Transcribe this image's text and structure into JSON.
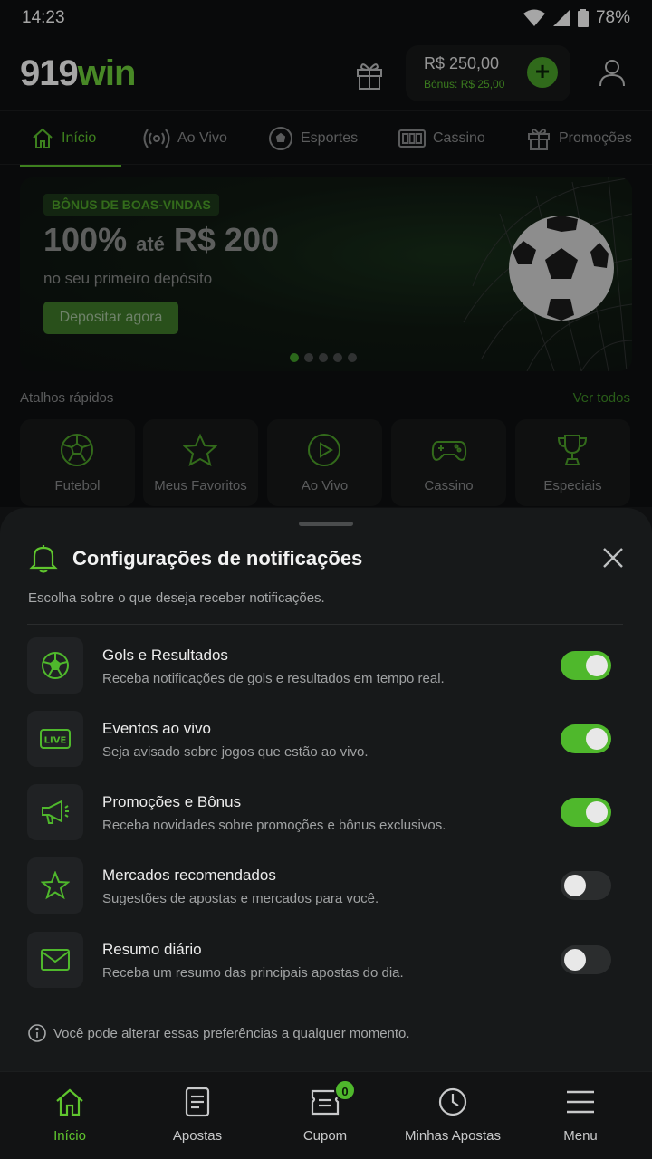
{
  "status_bar": {
    "time": "14:23",
    "battery": "78%"
  },
  "header": {
    "logo_main": "919",
    "logo_accent": "win",
    "balance": "R$ 250,00",
    "bonus": "Bônus: R$ 25,00"
  },
  "nav": {
    "tabs": [
      {
        "label": "Início",
        "icon": "home-icon"
      },
      {
        "label": "Ao Vivo",
        "icon": "live-icon"
      },
      {
        "label": "Esportes",
        "icon": "soccer-ball-icon"
      },
      {
        "label": "Cassino",
        "icon": "slot-machine-icon"
      },
      {
        "label": "Promoções",
        "icon": "gift-icon"
      }
    ]
  },
  "banner": {
    "badge": "BÔNUS DE BOAS-VINDAS",
    "title_pct": "100%",
    "title_mid": "até",
    "title_amount": "R$ 200",
    "subtitle": "no seu primeiro depósito",
    "cta": "Depositar agora",
    "slides": 5,
    "active_slide": 1
  },
  "shortcuts": {
    "title": "Atalhos rápidos",
    "see_all": "Ver todos",
    "items": [
      {
        "label": "Futebol",
        "icon": "soccer-ball-icon"
      },
      {
        "label": "Meus Favoritos",
        "icon": "star-icon"
      },
      {
        "label": "Ao Vivo",
        "icon": "play-icon"
      },
      {
        "label": "Cassino",
        "icon": "gamepad-icon"
      },
      {
        "label": "Especiais",
        "icon": "trophy-icon"
      }
    ]
  },
  "sheet": {
    "title": "Configurações de notificações",
    "description": "Escolha sobre o que deseja receber notificações.",
    "items": [
      {
        "title": "Gols e Resultados",
        "desc": "Receba notificações de gols e resultados em tempo real.",
        "enabled": true,
        "icon": "soccer-ball-icon"
      },
      {
        "title": "Eventos ao vivo",
        "desc": "Seja avisado sobre jogos que estão ao vivo.",
        "enabled": true,
        "icon": "live-badge-icon"
      },
      {
        "title": "Promoções e Bônus",
        "desc": "Receba novidades sobre promoções e bônus exclusivos.",
        "enabled": true,
        "icon": "megaphone-icon"
      },
      {
        "title": "Mercados recomendados",
        "desc": "Sugestões de apostas e mercados para você.",
        "enabled": false,
        "icon": "star-icon"
      },
      {
        "title": "Resumo diário",
        "desc": "Receba um resumo das principais apostas do dia.",
        "enabled": false,
        "icon": "mail-icon"
      }
    ],
    "info": "Você pode alterar essas preferências a qualquer momento."
  },
  "bottom_nav": {
    "items": [
      {
        "label": "Início",
        "icon": "home-icon"
      },
      {
        "label": "Apostas",
        "icon": "document-icon"
      },
      {
        "label": "Cupom",
        "icon": "coupon-icon",
        "badge": "0"
      },
      {
        "label": "Minhas Apostas",
        "icon": "clock-icon"
      },
      {
        "label": "Menu",
        "icon": "hamburger-icon"
      }
    ]
  },
  "colors": {
    "accent": "#5fc52e",
    "background": "#0f1011",
    "sheet": "#17191a"
  }
}
